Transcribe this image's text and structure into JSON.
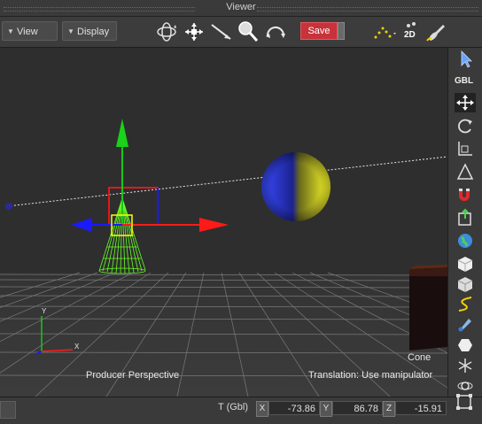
{
  "window": {
    "title": "Viewer"
  },
  "toolbar": {
    "view_label": "View",
    "display_label": "Display",
    "save_label": "Save",
    "mode_2d_label": "2D",
    "tools": [
      "orbit-icon",
      "pan-icon",
      "select-arrow-icon",
      "zoom-icon",
      "undo-view-icon"
    ]
  },
  "viewport": {
    "perspective_label": "Producer Perspective",
    "object_name": "Cone",
    "mode_text": "Translation: Use manipulator",
    "axis_y_label": "Y",
    "axis_x_label": "X"
  },
  "right_toolbar": {
    "gbl_label": "GBL",
    "tools": [
      "select-icon",
      "translate-icon",
      "rotate-icon",
      "scale-icon",
      "skew-icon",
      "magnet-icon",
      "export-icon",
      "globe-icon",
      "cube-icon",
      "cube-alt-icon",
      "path-icon",
      "dropper-icon",
      "hexagon-icon",
      "nodes-icon",
      "orbit-ring-icon",
      "light-icon",
      "frame-icon"
    ]
  },
  "status": {
    "transform_label": "T (Gbl)",
    "x_label": "X",
    "y_label": "Y",
    "z_label": "Z",
    "x_value": "-73.86",
    "y_value": "86.78",
    "z_value": "-15.91"
  },
  "colors": {
    "save_button": "#c8323a",
    "axis_x": "#ff1a1a",
    "axis_y": "#19c719",
    "axis_z": "#1a1aff",
    "cone_wire": "#66ff22",
    "selection_box": "#ffff00"
  }
}
